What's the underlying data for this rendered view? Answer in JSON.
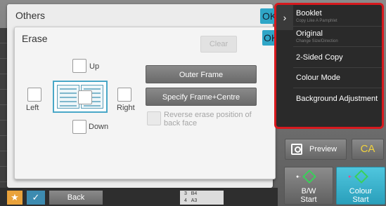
{
  "others": {
    "title": "Others",
    "ok": "OK"
  },
  "erase": {
    "title": "Erase",
    "ok": "OK",
    "clear": "Clear",
    "labels": {
      "up": "Up",
      "down": "Down",
      "left": "Left",
      "right": "Right"
    },
    "outer_frame": "Outer Frame",
    "frame_centre": "Specify Frame+Centre",
    "reverse": "Reverse erase position of back face"
  },
  "bottom": {
    "back": "Back",
    "trays": [
      {
        "num": "3",
        "size": "B4"
      },
      {
        "num": "4",
        "size": "A3"
      }
    ]
  },
  "right_panel": {
    "items": [
      {
        "label": "Booklet",
        "sub": "Copy Like A Pamphlet"
      },
      {
        "label": "Original",
        "sub": "Change Size/Direction"
      },
      {
        "label": "2-Sided Copy"
      },
      {
        "label": "Colour Mode"
      },
      {
        "label": "Background Adjustment"
      }
    ]
  },
  "actions": {
    "preview": "Preview",
    "ca": "CA",
    "bw_start": [
      "B/W",
      "Start"
    ],
    "colour_start": [
      "Colour",
      "Start"
    ]
  },
  "colors": {
    "ok": "#2fa6c7",
    "highlight_border": "#d7191e",
    "accent_star": "#e9a23b",
    "ca_text": "#f1d23d"
  }
}
